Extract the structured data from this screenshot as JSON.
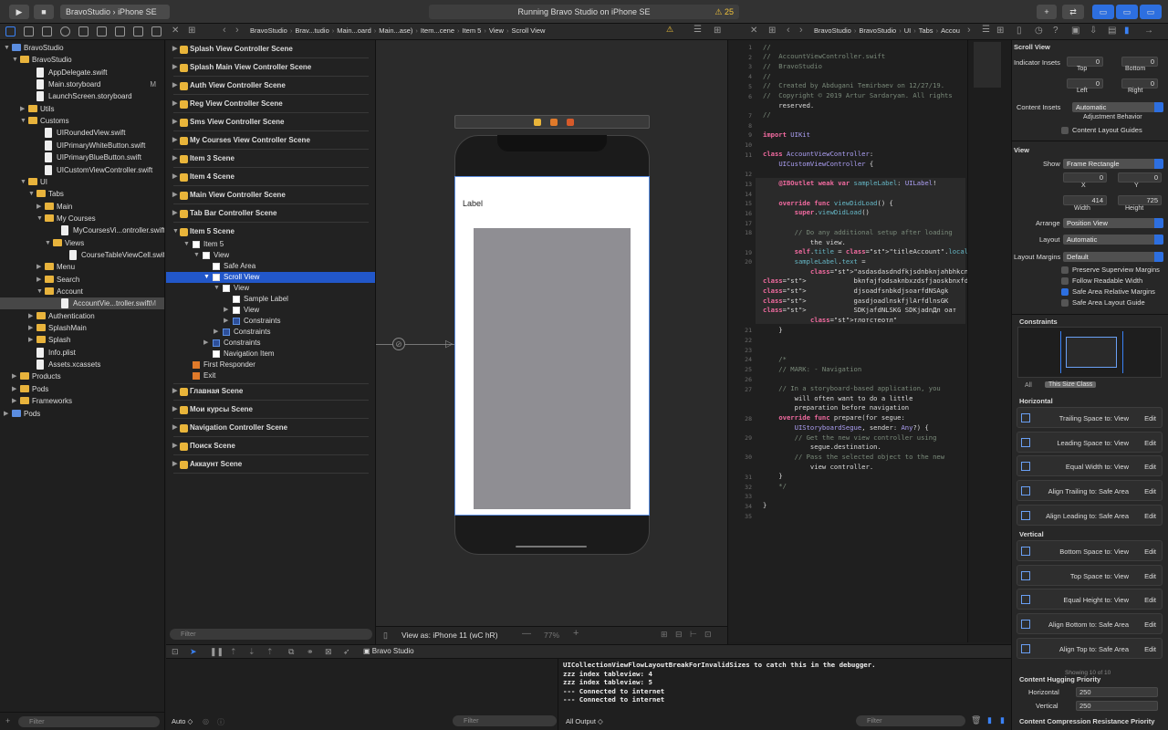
{
  "toolbar": {
    "scheme": "BravoStudio",
    "device": "iPhone SE",
    "status": "Running Bravo Studio on iPhone SE",
    "warning_count": "25"
  },
  "navigator": {
    "items": [
      {
        "label": "BravoStudio",
        "indent": 0,
        "kind": "project",
        "open": true
      },
      {
        "label": "BravoStudio",
        "indent": 1,
        "kind": "folder",
        "open": true
      },
      {
        "label": "AppDelegate.swift",
        "indent": 3,
        "kind": "file"
      },
      {
        "label": "Main.storyboard",
        "indent": 3,
        "kind": "file",
        "badge": "M"
      },
      {
        "label": "LaunchScreen.storyboard",
        "indent": 3,
        "kind": "file"
      },
      {
        "label": "Utils",
        "indent": 2,
        "kind": "folder",
        "open": false
      },
      {
        "label": "Customs",
        "indent": 2,
        "kind": "folder",
        "open": true
      },
      {
        "label": "UIRoundedView.swift",
        "indent": 4,
        "kind": "file"
      },
      {
        "label": "UIPrimaryWhiteButton.swift",
        "indent": 4,
        "kind": "file"
      },
      {
        "label": "UIPrimaryBlueButton.swift",
        "indent": 4,
        "kind": "file"
      },
      {
        "label": "UICustomViewController.swift",
        "indent": 4,
        "kind": "file"
      },
      {
        "label": "UI",
        "indent": 2,
        "kind": "folder",
        "open": true
      },
      {
        "label": "Tabs",
        "indent": 3,
        "kind": "folder",
        "open": true
      },
      {
        "label": "Main",
        "indent": 4,
        "kind": "folder",
        "open": false
      },
      {
        "label": "My Courses",
        "indent": 4,
        "kind": "folder",
        "open": true
      },
      {
        "label": "MyCoursesVi...ontroller.swift",
        "indent": 6,
        "kind": "file"
      },
      {
        "label": "Views",
        "indent": 5,
        "kind": "folder",
        "open": true
      },
      {
        "label": "CourseTableViewCell.swift",
        "indent": 7,
        "kind": "file"
      },
      {
        "label": "Menu",
        "indent": 4,
        "kind": "folder",
        "open": false
      },
      {
        "label": "Search",
        "indent": 4,
        "kind": "folder",
        "open": false
      },
      {
        "label": "Account",
        "indent": 4,
        "kind": "folder",
        "open": true
      },
      {
        "label": "AccountVie...troller.swift",
        "indent": 6,
        "kind": "file",
        "badge": "M",
        "selected": true
      },
      {
        "label": "Authentication",
        "indent": 3,
        "kind": "folder",
        "open": false
      },
      {
        "label": "SplashMain",
        "indent": 3,
        "kind": "folder",
        "open": false
      },
      {
        "label": "Splash",
        "indent": 3,
        "kind": "folder",
        "open": false
      },
      {
        "label": "Info.plist",
        "indent": 3,
        "kind": "file"
      },
      {
        "label": "Assets.xcassets",
        "indent": 3,
        "kind": "file"
      },
      {
        "label": "Products",
        "indent": 1,
        "kind": "folder",
        "open": false
      },
      {
        "label": "Pods",
        "indent": 1,
        "kind": "folder",
        "open": false
      },
      {
        "label": "Frameworks",
        "indent": 1,
        "kind": "folder",
        "open": false
      },
      {
        "label": "Pods",
        "indent": 0,
        "kind": "project",
        "open": false
      }
    ],
    "filter_placeholder": "Filter"
  },
  "breadcrumb": {
    "left": [
      "BravoStudio",
      "Brav...tudio",
      "Main...oard",
      "Main...ase)",
      "Item...cene",
      "Item 5",
      "View",
      "Scroll View"
    ],
    "right": [
      "BravoStudio",
      "BravoStudio",
      "UI",
      "Tabs",
      "Account",
      "AccountViewController.swift"
    ]
  },
  "outline": {
    "top_scenes": [
      "Splash View Controller Scene",
      "Splash Main View Controller Scene",
      "Auth View Controller Scene",
      "Reg View Controller Scene",
      "Sms View Controller Scene",
      "My Courses View Controller Scene",
      "Item 3 Scene",
      "Item 4 Scene",
      "Main View Controller Scene",
      "Tab Bar Controller Scene",
      "Item 5 Scene"
    ],
    "tree": [
      {
        "label": "Item 5",
        "indent": 1
      },
      {
        "label": "View",
        "indent": 2
      },
      {
        "label": "Safe Area",
        "indent": 3
      },
      {
        "label": "Scroll View",
        "indent": 3,
        "selected": true
      },
      {
        "label": "View",
        "indent": 4
      },
      {
        "label": "Sample Label",
        "indent": 5
      },
      {
        "label": "View",
        "indent": 5
      },
      {
        "label": "Constraints",
        "indent": 5
      },
      {
        "label": "Constraints",
        "indent": 4
      },
      {
        "label": "Constraints",
        "indent": 3
      },
      {
        "label": "Navigation Item",
        "indent": 3
      },
      {
        "label": "First Responder",
        "indent": 1
      },
      {
        "label": "Exit",
        "indent": 1
      }
    ],
    "bottom_scenes": [
      "Главная Scene",
      "Мои курсы Scene",
      "Navigation Controller Scene",
      "Поиск Scene",
      "Аккаунт Scene"
    ],
    "filter_placeholder": "Filter"
  },
  "canvas": {
    "label_text": "Label",
    "view_as": "View as: iPhone 11",
    "traits": "(wC hR)",
    "zoom": "77%"
  },
  "code": {
    "lines": [
      {
        "n": "1",
        "t": "//"
      },
      {
        "n": "2",
        "t": "//  AccountViewController.swift"
      },
      {
        "n": "3",
        "t": "//  BravoStudio"
      },
      {
        "n": "4",
        "t": "//"
      },
      {
        "n": "5",
        "t": "//  Created by Abdugani Temirbaev on 12/27/19."
      },
      {
        "n": "6",
        "t": "//  Copyright © 2019 Artur Sardaryan. All rights"
      },
      {
        "n": "",
        "t": "    reserved."
      },
      {
        "n": "7",
        "t": "//"
      },
      {
        "n": "8",
        "t": ""
      },
      {
        "n": "9",
        "t": "import UIKit"
      },
      {
        "n": "10",
        "t": ""
      },
      {
        "n": "11",
        "t": "class AccountViewController:"
      },
      {
        "n": "",
        "t": "    UICustomViewController {"
      },
      {
        "n": "12",
        "t": ""
      },
      {
        "n": "13",
        "t": "    @IBOutlet weak var sampleLabel: UILabel!"
      },
      {
        "n": "14",
        "t": ""
      },
      {
        "n": "15",
        "t": "    override func viewDidLoad() {"
      },
      {
        "n": "16",
        "t": "        super.viewDidLoad()"
      },
      {
        "n": "17",
        "t": ""
      },
      {
        "n": "18",
        "t": "        // Do any additional setup after loading"
      },
      {
        "n": "",
        "t": "            the view."
      },
      {
        "n": "19",
        "t": "        self.title = \"titleAccount\".localized()"
      },
      {
        "n": "20",
        "t": "        sampleLabel.text ="
      },
      {
        "n": "",
        "t": "            \"asdasdasdndfkjsdnbknjahbhkcnkjfdaogh"
      },
      {
        "n": "",
        "t": "            bknfajfodsaknbxzdsfjaoskbnxfdjsoasnkb"
      },
      {
        "n": "",
        "t": "            djsoadfsnbkdjsoarfdNSAgk"
      },
      {
        "n": "",
        "t": "            gasdjoadlnskfjlArfdlnsGK"
      },
      {
        "n": "",
        "t": "            SDKjafdNLSKG SDKjadnДл оат"
      },
      {
        "n": "",
        "t": "            тлотстеотл\""
      },
      {
        "n": "21",
        "t": "    }"
      },
      {
        "n": "22",
        "t": ""
      },
      {
        "n": "23",
        "t": ""
      },
      {
        "n": "24",
        "t": "    /*"
      },
      {
        "n": "25",
        "t": "    // MARK: - Navigation"
      },
      {
        "n": "26",
        "t": ""
      },
      {
        "n": "27",
        "t": "    // In a storyboard-based application, you"
      },
      {
        "n": "",
        "t": "        will often want to do a little"
      },
      {
        "n": "",
        "t": "        preparation before navigation"
      },
      {
        "n": "28",
        "t": "    override func prepare(for segue:"
      },
      {
        "n": "",
        "t": "        UIStoryboardSegue, sender: Any?) {"
      },
      {
        "n": "29",
        "t": "        // Get the new view controller using"
      },
      {
        "n": "",
        "t": "            segue.destination."
      },
      {
        "n": "30",
        "t": "        // Pass the selected object to the new"
      },
      {
        "n": "",
        "t": "            view controller."
      },
      {
        "n": "31",
        "t": "    }"
      },
      {
        "n": "32",
        "t": "    */"
      },
      {
        "n": "33",
        "t": ""
      },
      {
        "n": "34",
        "t": "}"
      },
      {
        "n": "35",
        "t": ""
      }
    ]
  },
  "inspector": {
    "scroll_view_title": "Scroll View",
    "indicator_insets_label": "Indicator Insets",
    "top_label": "Top",
    "bottom_label": "Bottom",
    "left_label": "Left",
    "right_label": "Right",
    "insets": {
      "top": "0",
      "bottom": "0",
      "left": "0",
      "right": "0"
    },
    "content_insets_label": "Content Insets",
    "content_insets_value": "Automatic",
    "adjustment_behavior": "Adjustment Behavior",
    "content_layout_guides": "Content Layout Guides",
    "view_title": "View",
    "show_label": "Show",
    "show_value": "Frame Rectangle",
    "x_val": "0",
    "y_val": "0",
    "x_label": "X",
    "y_label": "Y",
    "width_val": "414",
    "height_val": "725",
    "width_label": "Width",
    "height_label": "Height",
    "arrange_label": "Arrange",
    "arrange_value": "Position View",
    "layout_label": "Layout",
    "layout_value": "Automatic",
    "layout_margins_label": "Layout Margins",
    "layout_margins_value": "Default",
    "checks": [
      {
        "label": "Preserve Superview Margins",
        "on": false
      },
      {
        "label": "Follow Readable Width",
        "on": false
      },
      {
        "label": "Safe Area Relative Margins",
        "on": true
      },
      {
        "label": "Safe Area Layout Guide",
        "on": false
      }
    ],
    "constraints_title": "Constraints",
    "size_tabs": {
      "all": "All",
      "this": "This Size Class"
    },
    "horizontal_title": "Horizontal",
    "horizontal": [
      {
        "label": "Trailing Space to:",
        "target": "View"
      },
      {
        "label": "Leading Space to:",
        "target": "View"
      },
      {
        "label": "Equal Width to:",
        "target": "View"
      },
      {
        "label": "Align Trailing to:",
        "target": "Safe Area"
      },
      {
        "label": "Align Leading to:",
        "target": "Safe Area"
      }
    ],
    "vertical_title": "Vertical",
    "vertical": [
      {
        "label": "Bottom Space to:",
        "target": "View"
      },
      {
        "label": "Top Space to:",
        "target": "View"
      },
      {
        "label": "Equal Height to:",
        "target": "View"
      },
      {
        "label": "Align Bottom to:",
        "target": "Safe Area"
      },
      {
        "label": "Align Top to:",
        "target": "Safe Area"
      }
    ],
    "edit_label": "Edit",
    "showing": "Showing 10 of 10",
    "hugging_title": "Content Hugging Priority",
    "horizontal_label": "Horizontal",
    "vertical_label": "Vertical",
    "hugging_h": "250",
    "hugging_v": "250",
    "compression_title": "Content Compression Resistance Priority"
  },
  "debug": {
    "target": "Bravo Studio",
    "auto_label": "Auto",
    "output_label": "All Output",
    "filter_placeholder": "Filter",
    "console_lines": [
      "UICollectionViewFlowLayoutBreakForInvalidSizes to catch this in the debugger.",
      "zzz index tableview: 4",
      "zzz index tableview: 5",
      "--- Connected to internet",
      "--- Connected to internet"
    ]
  }
}
